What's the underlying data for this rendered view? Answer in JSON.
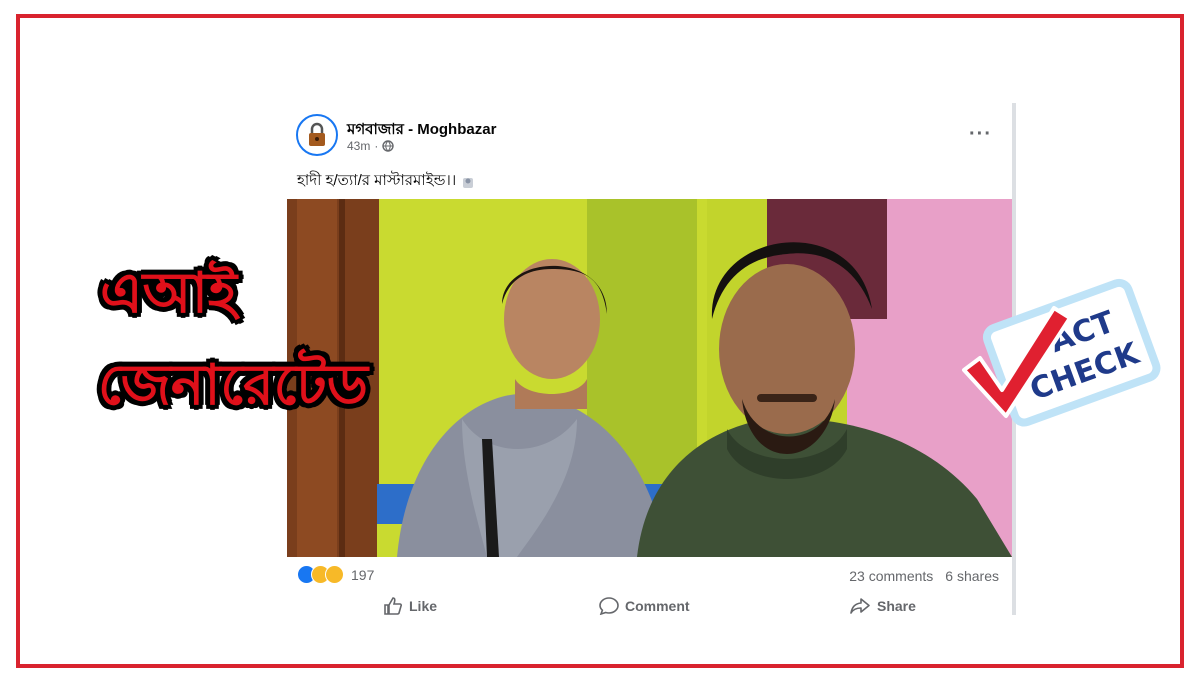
{
  "post": {
    "page_name": "মগবাজার",
    "page_name_en": "Moghbazar",
    "separator": "-",
    "time": "43m",
    "privacy_dot": "·",
    "caption": "হাদী হ/ত্যা/র মাস্টারমাইন্ড।।",
    "more_label": "···",
    "reaction_count": "197",
    "comments": "23 comments",
    "shares": "6 shares",
    "actions": {
      "like": "Like",
      "comment": "Comment",
      "share": "Share"
    }
  },
  "overlay": {
    "line1": "এআই",
    "line2": "জেনারেটেড"
  },
  "badge": {
    "word1": "FACT",
    "word2": "CHECK"
  },
  "colors": {
    "frame": "#d9232e",
    "ai_text": "#e0101a",
    "facebook_blue": "#1877f2",
    "check_red": "#e02030",
    "badge_text": "#1f3a8a"
  },
  "icons": {
    "avatar": "padlock-avatar-icon",
    "privacy": "globe-icon",
    "like_reaction": "thumbs-up-icon",
    "haha_reaction": "laugh-emoji-icon",
    "wow_reaction": "wow-emoji-icon",
    "like_action": "thumbs-up-outline-icon",
    "comment_action": "comment-bubble-icon",
    "share_action": "share-arrow-icon"
  }
}
